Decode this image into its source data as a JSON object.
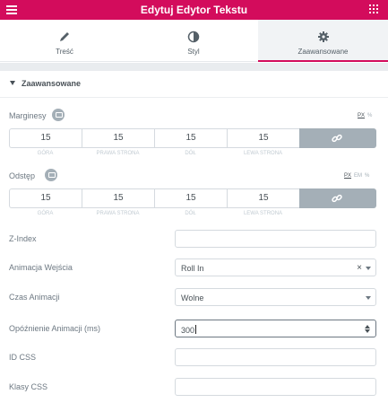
{
  "header": {
    "title": "Edytuj Edytor Tekstu"
  },
  "tabs": [
    {
      "label": "Treść",
      "icon": "pencil-icon"
    },
    {
      "label": "Styl",
      "icon": "half-circle-icon"
    },
    {
      "label": "Zaawansowane",
      "icon": "gear-icon",
      "active": true
    }
  ],
  "section": {
    "title": "Zaawansowane"
  },
  "margins": {
    "label": "Marginesy",
    "units": [
      "PX",
      "%"
    ],
    "active_unit": "PX",
    "values": [
      "15",
      "15",
      "15",
      "15"
    ],
    "sublabels": [
      "GÓRA",
      "PRAWA STRONA",
      "DÓŁ",
      "LEWA STRONA"
    ]
  },
  "padding": {
    "label": "Odstęp",
    "units": [
      "PX",
      "EM",
      "%"
    ],
    "active_unit": "PX",
    "values": [
      "15",
      "15",
      "15",
      "15"
    ],
    "sublabels": [
      "GÓRA",
      "PRAWA STRONA",
      "DÓŁ",
      "LEWA STRONA"
    ]
  },
  "fields": {
    "zindex": {
      "label": "Z-Index",
      "value": ""
    },
    "entrance_animation": {
      "label": "Animacja Wejścia",
      "value": "Roll In"
    },
    "animation_duration": {
      "label": "Czas Animacji",
      "value": "Wolne"
    },
    "animation_delay": {
      "label": "Opóźnienie Animacji (ms)",
      "value": "300"
    },
    "css_id": {
      "label": "ID CSS",
      "value": ""
    },
    "css_classes": {
      "label": "Klasy CSS",
      "value": ""
    }
  },
  "colors": {
    "brand": "#d30c5c",
    "link_button": "#a4afb7"
  }
}
